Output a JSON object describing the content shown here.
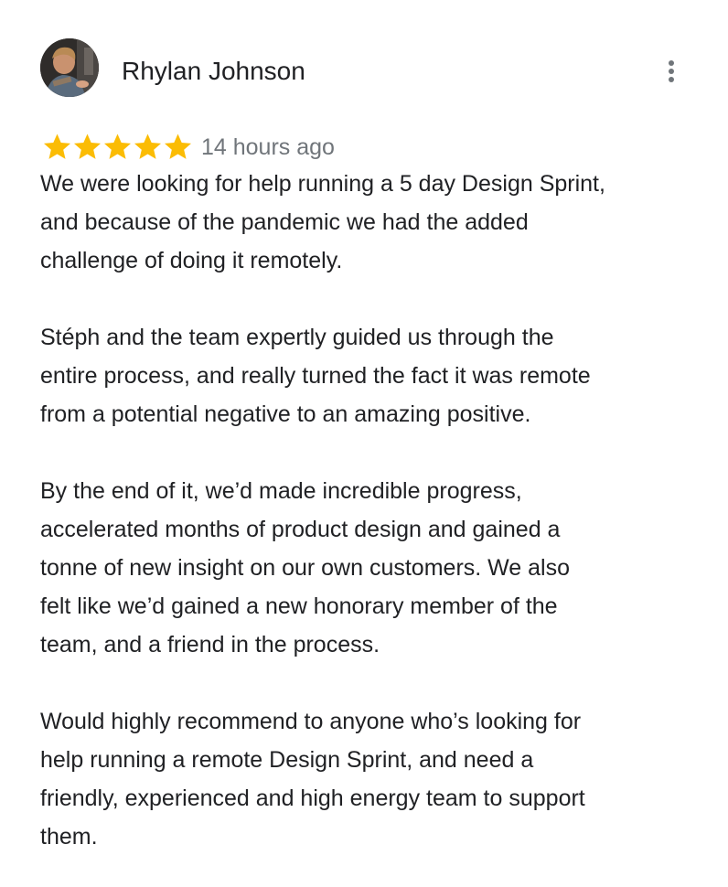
{
  "review": {
    "author": {
      "name": "Rhylan Johnson",
      "avatar_icon": "user-photo-avatar"
    },
    "more_options_icon": "more-vert-icon",
    "rating": {
      "stars": 5,
      "max": 5,
      "star_color": "#fbbc04",
      "time_ago": "14 hours ago"
    },
    "paragraphs": [
      "We were looking for help running a 5 day Design Sprint,\nand because of the pandemic we had the added\nchallenge of doing it remotely.",
      "Stéph and the team expertly guided us through the\nentire process, and really turned the fact it was remote\nfrom a potential negative to an amazing positive.",
      "By the end of it, we’d made incredible progress,\naccelerated months of product design and gained a\ntonne of new insight on our own customers. We also\nfelt like we’d gained a new honorary member of the\nteam, and a friend in the process.",
      "Would highly recommend to anyone who’s looking for\nhelp running a remote Design Sprint, and need a\nfriendly, experienced and high energy team to support\nthem."
    ]
  },
  "colors": {
    "text_primary": "#202124",
    "text_secondary": "#70757a",
    "star": "#fbbc04"
  }
}
